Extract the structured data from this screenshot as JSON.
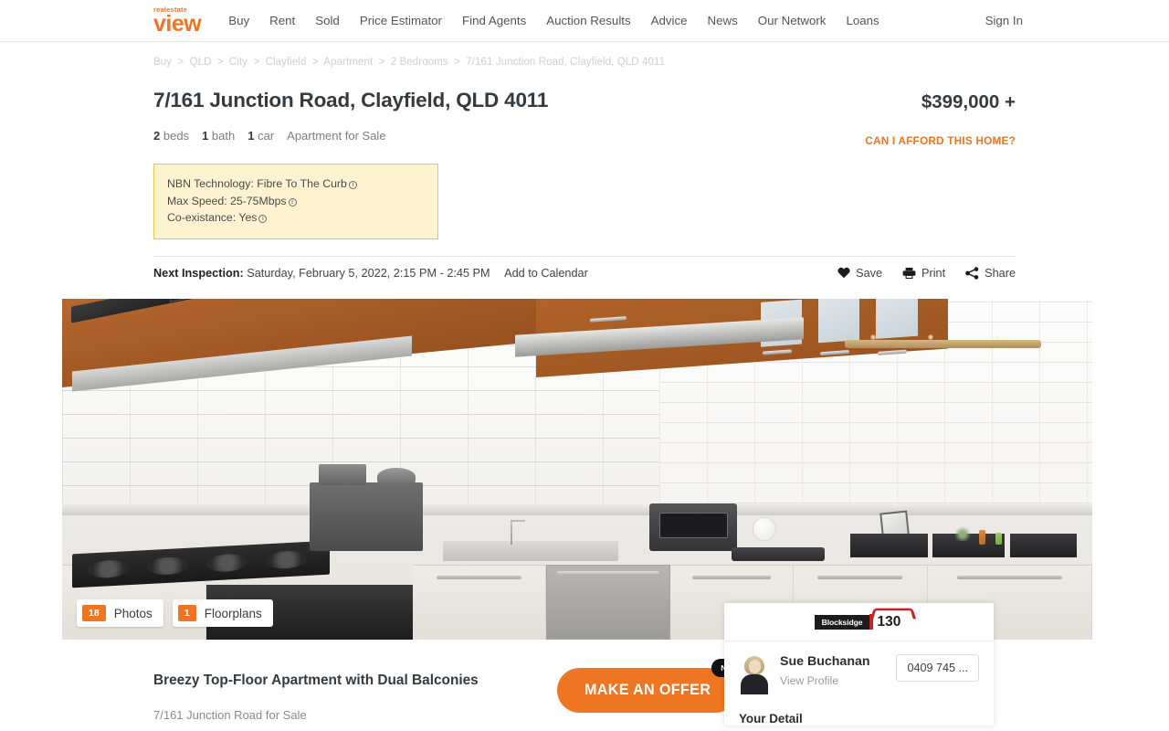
{
  "header": {
    "logo_top": "realestate",
    "logo_main": "view",
    "nav": [
      {
        "label": "Buy"
      },
      {
        "label": "Rent"
      },
      {
        "label": "Sold"
      },
      {
        "label": "Price Estimator"
      },
      {
        "label": "Find Agents"
      },
      {
        "label": "Auction Results"
      },
      {
        "label": "Advice"
      },
      {
        "label": "News"
      },
      {
        "label": "Our Network"
      },
      {
        "label": "Loans"
      }
    ],
    "sign_in": "Sign In"
  },
  "breadcrumb": [
    "Buy",
    "QLD",
    "City",
    "Clayfield",
    "Apartment",
    "2 Bedrooms",
    "7/161 Junction Road, Clayfield, QLD 4011"
  ],
  "breadcrumb_separator": ">",
  "listing": {
    "title": "7/161 Junction Road, Clayfield, QLD 4011",
    "price": "$399,000 +",
    "afford_link": "CAN I AFFORD THIS HOME?",
    "features": {
      "beds_count": "2",
      "beds_label": "beds",
      "bath_count": "1",
      "bath_label": "bath",
      "car_count": "1",
      "car_label": "car",
      "property_type": "Apartment for Sale"
    }
  },
  "nbn": {
    "technology": "NBN Technology: Fibre To The Curb",
    "max_speed": "Max Speed: 25-75Mbps",
    "co_existance": "Co-existance: Yes",
    "info_glyph": "i"
  },
  "inspection": {
    "label": "Next Inspection:",
    "datetime": "Saturday, February 5, 2022, 2:15 PM - 2:45 PM",
    "add_to_calendar": "Add to Calendar",
    "actions": [
      {
        "label": "Save",
        "icon": "heart-icon"
      },
      {
        "label": "Print",
        "icon": "printer-icon"
      },
      {
        "label": "Share",
        "icon": "share-icon"
      }
    ]
  },
  "gallery": {
    "photos_count": "18",
    "photos_label": "Photos",
    "floorplans_count": "1",
    "floorplans_label": "Floorplans"
  },
  "agent": {
    "agency_name": "Blocksidge",
    "agency_number": "130",
    "name": "Sue Buchanan",
    "view_profile": "View Profile",
    "phone": "0409 745 ...",
    "your_detail": "Your Detail"
  },
  "bottom": {
    "headline": "Breezy Top-Floor Apartment with Dual Balconies",
    "subline": "7/161 Junction Road for Sale",
    "offer_button": "MAKE AN OFFER",
    "new_badge": "NEW"
  },
  "colors": {
    "brand_orange": "#ee7623",
    "nbn_bg": "#fdf3d1",
    "nbn_border": "#e8c84a",
    "text_dark": "#333a40",
    "agency_red": "#cc1f24"
  }
}
